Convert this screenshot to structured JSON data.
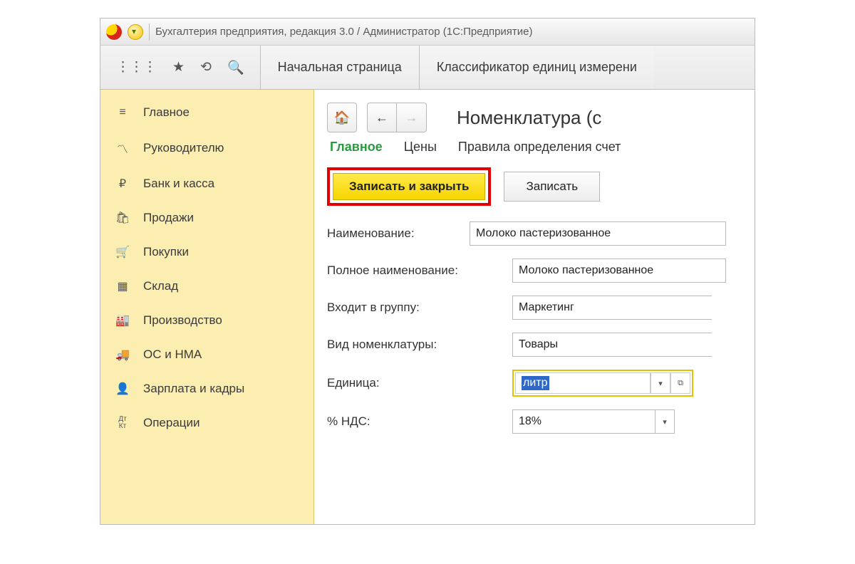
{
  "titlebar": {
    "text": "Бухгалтерия предприятия, редакция 3.0 / Администратор   (1С:Предприятие)"
  },
  "tabbar": {
    "tabs": [
      "Начальная страница",
      "Классификатор единиц измерени"
    ]
  },
  "sidebar": {
    "items": [
      {
        "icon": "≡",
        "label": "Главное"
      },
      {
        "icon": "📈",
        "label": "Руководителю"
      },
      {
        "icon": "₽",
        "label": "Банк и касса"
      },
      {
        "icon": "🛍",
        "label": "Продажи"
      },
      {
        "icon": "🛒",
        "label": "Покупки"
      },
      {
        "icon": "▦",
        "label": "Склад"
      },
      {
        "icon": "🏭",
        "label": "Производство"
      },
      {
        "icon": "🚚",
        "label": "ОС и НМА"
      },
      {
        "icon": "👤",
        "label": "Зарплата и кадры"
      },
      {
        "icon": "Дт",
        "label": "Операции"
      }
    ]
  },
  "main": {
    "page_title": "Номенклатура (с",
    "subnav": [
      "Главное",
      "Цены",
      "Правила определения счет"
    ],
    "buttons": {
      "save_close": "Записать и закрыть",
      "save": "Записать"
    },
    "fields": {
      "name_label": "Наименование:",
      "name_value": "Молоко пастеризованное",
      "full_name_label": "Полное наименование:",
      "full_name_value": "Молоко пастеризованное",
      "group_label": "Входит в группу:",
      "group_value": "Маркетинг",
      "type_label": "Вид номенклатуры:",
      "type_value": "Товары",
      "unit_label": "Единица:",
      "unit_value": "литр",
      "vat_label": "% НДС:",
      "vat_value": "18%"
    }
  }
}
